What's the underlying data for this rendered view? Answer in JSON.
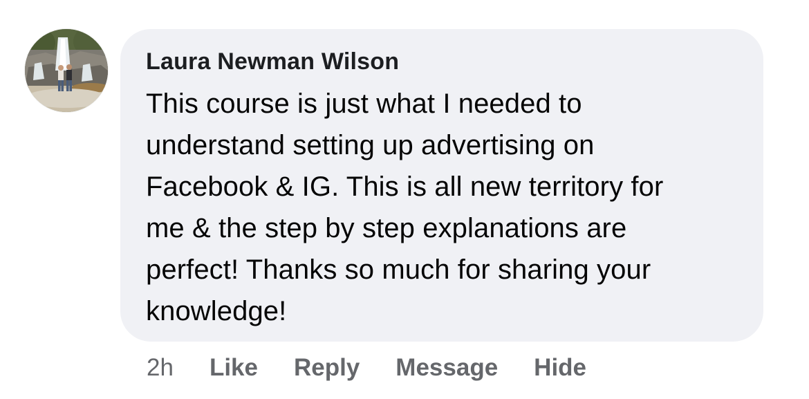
{
  "comment": {
    "author": "Laura Newman Wilson",
    "text": "This course is just what I needed to\nunderstand setting up advertising on\nFacebook & IG. This is all new territory for\nme & the step by step explanations are\nperfect! Thanks so much for sharing your\nknowledge!",
    "avatar_icon": "profile-photo-waterfall"
  },
  "actions": {
    "timestamp": "2h",
    "like_label": "Like",
    "reply_label": "Reply",
    "message_label": "Message",
    "hide_label": "Hide"
  },
  "colors": {
    "bubble_bg": "#f0f1f5",
    "text": "#050505",
    "action_text": "#65676b"
  }
}
